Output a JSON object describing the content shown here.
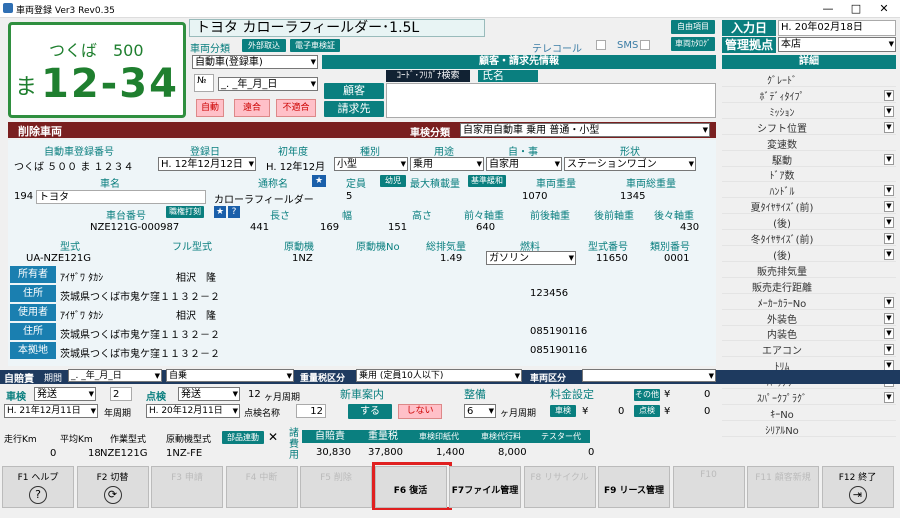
{
  "window": {
    "title": "車両登録 Ver3 Rev0.35",
    "min": "—",
    "max": "□",
    "close": "✕"
  },
  "plate": {
    "region": "つくば　500",
    "kana": "ま",
    "number": "12-34"
  },
  "car_name": "トヨタ カローラフィールダー･1.5L",
  "header": {
    "jiyu": "自由項目",
    "katalog": "車両ｶﾀﾛｸﾞ",
    "nyuko_label": "入力日",
    "nyuko_value": "H. 20年02月18日",
    "kanri_label": "管理拠点",
    "kanri_value": "本店",
    "telecall": "テレコール",
    "sms": "SMS"
  },
  "bunrui": {
    "label": "車両分類",
    "gaibu": "外部取込",
    "denshi": "電子車検証",
    "value": "自動車(登録車)",
    "date": "_. _年_月_日"
  },
  "buttons": {
    "jido": "自動",
    "goudou": "遠合",
    "futekigo": "不適合"
  },
  "customer": {
    "header": "顧客・請求先情報",
    "kana_search": "ｺｰﾄﾞ･ﾌﾘｶﾞﾅ検索",
    "name_label": "氏名",
    "kokyaku": "顧客",
    "seikyu": "請求先"
  },
  "detail": {
    "header": "詳細",
    "items": [
      {
        "label": "ｸﾞﾚｰﾄﾞ",
        "dd": false
      },
      {
        "label": "ﾎﾞﾃﾞｨﾀｲﾌﾟ",
        "dd": true
      },
      {
        "label": "ﾐｯｼｮﾝ",
        "dd": true
      },
      {
        "label": "シフト位置",
        "dd": true
      },
      {
        "label": "変速数",
        "dd": false
      },
      {
        "label": "駆動",
        "dd": true
      },
      {
        "label": "ﾄﾞｱ数",
        "dd": false
      },
      {
        "label": "ﾊﾝﾄﾞﾙ",
        "dd": true
      },
      {
        "label": "夏ﾀｲﾔｻｲｽﾞ(前)",
        "dd": true
      },
      {
        "label": "(後)",
        "dd": true
      },
      {
        "label": "冬ﾀｲﾔｻｲｽﾞ(前)",
        "dd": true
      },
      {
        "label": "(後)",
        "dd": true
      },
      {
        "label": "販売排気量",
        "dd": false
      },
      {
        "label": "販売走行距離",
        "dd": false
      },
      {
        "label": "ﾒｰｶｰｶﾗｰNo",
        "dd": true
      },
      {
        "label": "外装色",
        "dd": true
      },
      {
        "label": "内装色",
        "dd": true
      },
      {
        "label": "エアコン",
        "dd": true
      },
      {
        "label": "ﾄﾘﾑ",
        "dd": true
      },
      {
        "label": "ﾊﾞｯﾃﾘｰ",
        "dd": true
      },
      {
        "label": "ｽﾊﾟｰｸﾌﾟﾗｸﾞ",
        "dd": true
      },
      {
        "label": "ｷｰNo",
        "dd": false
      },
      {
        "label": "ｼﾘｱﾙNo",
        "dd": false
      }
    ]
  },
  "section": {
    "title": "削除車両",
    "bunrui_label": "車検分類",
    "bunrui_value": "自家用自動車 乗用 普通・小型"
  },
  "reg": {
    "h_touroku": "自動車登録番号",
    "h_date": "登録日",
    "h_shonendo": "初年度",
    "h_shubetsu": "種別",
    "h_yoto": "用途",
    "h_jiei": "自・事",
    "h_keijo": "形状",
    "touroku": "つくば ５００ ま １２３４",
    "date": "H. 12年12月12日",
    "shonendo": "H. 12年12月",
    "shubetsu": "小型",
    "yoto": "乗用",
    "jiei": "自家用",
    "keijo": "ステーションワゴン"
  },
  "row2": {
    "h_shamei": "車名",
    "h_tsusho": "通称名",
    "h_teiin": "定員",
    "youjo": "幼児",
    "h_saidai": "最大積載量",
    "kijun": "基準緩和",
    "h_sharyo": "車両重量",
    "h_sou": "車両総重量",
    "code": "194",
    "shamei": "トヨタ",
    "tsusho": "カローラフィールダー",
    "teiin": "5",
    "sharyo": "1070",
    "sou": "1345"
  },
  "row3": {
    "h_shadai": "車台番号",
    "shokuho": "職権打刻",
    "h_naga": "長さ",
    "h_haba": "幅",
    "h_taka": "高さ",
    "h_mae": "前々軸重",
    "h_mae2": "前後軸重",
    "h_ato": "後前軸重",
    "h_ato2": "後々軸重",
    "shadai": "NZE121G-000987",
    "naga": "441",
    "haba": "169",
    "taka": "151",
    "mae": "640",
    "ato2": "430"
  },
  "row4": {
    "h_katashiki": "型式",
    "h_full": "フル型式",
    "h_genki": "原動機",
    "h_genkino": "原動機No",
    "h_haiki": "総排気量",
    "h_nenryo": "燃料",
    "h_katashikino": "型式番号",
    "h_ruibetsu": "類別番号",
    "katashiki": "UA-NZE121G",
    "genki": "1NZ",
    "haiki": "1.49",
    "nenryo": "ガソリン",
    "katashikino": "11650",
    "ruibetsu": "0001"
  },
  "persons": [
    {
      "label": "所有者",
      "kana": "ｱｲｻﾞﾜ ﾀｶｼ",
      "name": "相沢　隆",
      "tel": ""
    },
    {
      "label": "住所",
      "addr": "茨城県つくば市鬼ケ窪１１３２－２",
      "tel": "123456"
    },
    {
      "label": "使用者",
      "kana": "ｱｲｻﾞﾜ ﾀｶｼ",
      "name": "相沢　隆",
      "tel": ""
    },
    {
      "label": "住所",
      "addr": "茨城県つくば市鬼ケ窪１１３２－２",
      "tel": "085190116"
    },
    {
      "label": "本拠地",
      "addr": "茨城県つくば市鬼ケ窪１１３２－２",
      "tel": "085190116"
    }
  ],
  "bottom": {
    "jibaiseki": "自賠責",
    "kikan": "期間",
    "kikan_val": "_. _年_月_日",
    "kikan_val2": "自乗",
    "juryo": "重量税区分",
    "juryo_val": "乗用 (定員10人以下)",
    "sharyo_kubun": "車両区分",
    "shaken": "車検",
    "shaken_sel": "発送",
    "shaken_num": "2",
    "shaken_date": "H. 21年12月11日",
    "nenshuki": "年周期",
    "tenken": "点検",
    "tenken_sel": "発送",
    "tenken_num": "12",
    "tenken_date": "H. 20年12月11日",
    "kagetsu": "ヶ月周期",
    "tenken_kei": "点検名称",
    "tenken_kei_val": "12",
    "shinsha": "新車案内",
    "suru": "する",
    "shinai": "しない",
    "seibi": "整備",
    "seibi_val": "6",
    "seibi_unit": "ヶ月周期",
    "ryokin": "料金設定",
    "sonota": "その他",
    "sonota_val": "0",
    "shaken_fee": "車検",
    "shaken_fee_val": "0",
    "tenken_fee": "点検",
    "tenken_fee_val": "0",
    "yen": "¥"
  },
  "cost": {
    "h_soko": "走行Km",
    "h_heikin": "平均Km",
    "h_sagyo": "作業型式",
    "h_genki": "原動機型式",
    "buhin": "部品連動",
    "x": "✕",
    "shoyo": "諸費用",
    "h_jibai": "自賠責",
    "h_juryo": "重量税",
    "h_inshi": "車検印紙代",
    "h_daiko": "車検代行料",
    "h_test": "テスター代",
    "soko": "0",
    "heikin": "18",
    "sagyo": "NZE121G",
    "genki": "1NZ-FE",
    "jibai": "30,830",
    "juryo": "37,800",
    "inshi": "1,400",
    "daiko": "8,000",
    "test": "0"
  },
  "fkeys": [
    {
      "key": "F1 ヘルプ",
      "icon": "?",
      "dis": false
    },
    {
      "key": "F2 切替",
      "icon": "⟳",
      "dis": false
    },
    {
      "key": "F3 申請",
      "icon": "",
      "dis": true
    },
    {
      "key": "F4 中断",
      "icon": "",
      "dis": true
    },
    {
      "key": "F5 削除",
      "icon": "",
      "dis": true
    },
    {
      "key": "F6 復活",
      "icon": "",
      "dis": false
    },
    {
      "key": "F7ファイル管理",
      "icon": "",
      "dis": false
    },
    {
      "key": "F8 リサイクル",
      "icon": "",
      "dis": true
    },
    {
      "key": "F9 リース管理",
      "icon": "",
      "dis": false
    },
    {
      "key": "F10",
      "icon": "",
      "dis": true
    },
    {
      "key": "F11 顧客新規",
      "icon": "",
      "dis": true
    },
    {
      "key": "F12 終了",
      "icon": "⇥",
      "dis": false
    }
  ]
}
